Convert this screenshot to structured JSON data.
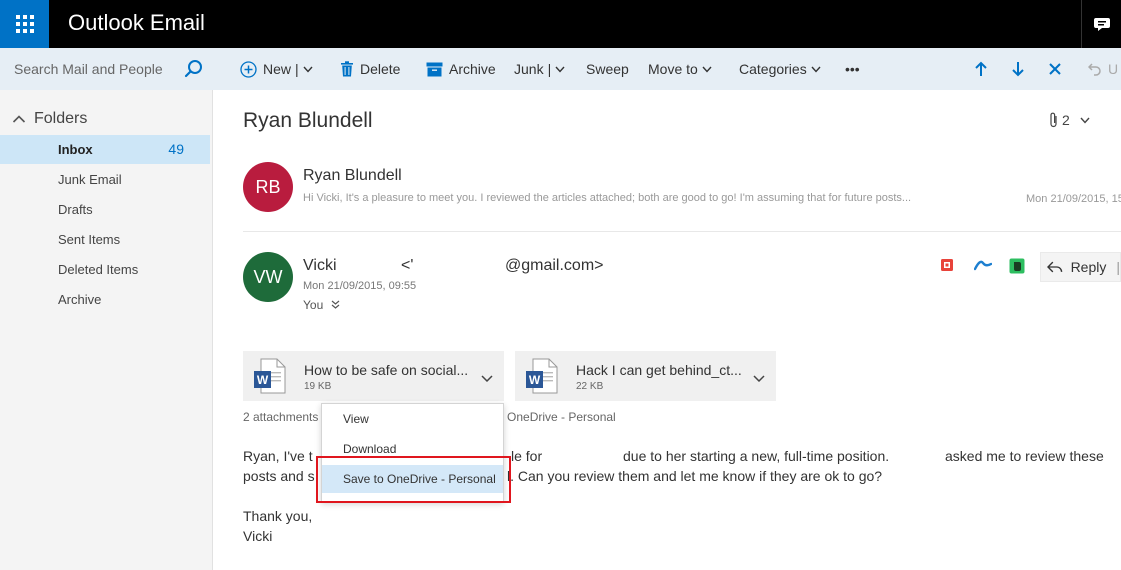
{
  "app": {
    "title": "Outlook Email"
  },
  "search": {
    "placeholder": "Search Mail and People"
  },
  "folders": {
    "heading": "Folders",
    "items": [
      {
        "label": "Inbox",
        "count": "49",
        "selected": true
      },
      {
        "label": "Junk Email"
      },
      {
        "label": "Drafts"
      },
      {
        "label": "Sent Items"
      },
      {
        "label": "Deleted Items"
      },
      {
        "label": "Archive"
      }
    ]
  },
  "toolbar": {
    "new": "New",
    "delete": "Delete",
    "archive": "Archive",
    "junk": "Junk",
    "sweep": "Sweep",
    "move_to": "Move to",
    "categories": "Categories",
    "more": "•••",
    "undo": "U"
  },
  "conversation": {
    "subject": "Ryan Blundell",
    "attachment_count": "2",
    "messages": [
      {
        "initials": "RB",
        "sender": "Ryan Blundell",
        "preview": "Hi Vicki, It's a pleasure to meet you. I reviewed the articles attached; both are good to go! I'm assuming that for future posts...",
        "date": "Mon 21/09/2015, 15..."
      },
      {
        "initials": "VW",
        "sender": "Vicki",
        "email_open": "<'",
        "email": "@gmail.com>",
        "date": "Mon 21/09/2015, 09:55",
        "to": "You"
      }
    ],
    "reply_label": "Reply"
  },
  "attachments": [
    {
      "name": "How to be safe on social...",
      "size": "19 KB"
    },
    {
      "name": "Hack I can get behind_ct...",
      "size": "22 KB"
    }
  ],
  "attachments_footer": {
    "prefix": "2 attachments (",
    "suffix": "o OneDrive - Personal"
  },
  "body": {
    "line1_a": "Ryan, I've t",
    "line1_b": "le for",
    "line1_c": "due to her starting a new, full-time position.",
    "line1_d": "asked me to review these",
    "line2_a": "posts and s",
    "line2_b": "l. Can you review them and let me know if they are ok to go?",
    "closing": "Thank you,",
    "signature": "Vicki"
  },
  "context_menu": {
    "items": [
      "View",
      "Download",
      "Save to OneDrive - Personal"
    ],
    "highlighted_index": 2
  },
  "colors": {
    "accent": "#0072c6",
    "rb_avatar": "#b91c3e",
    "vw_avatar": "#1e6b3a",
    "highlight_box": "#e0161e"
  }
}
